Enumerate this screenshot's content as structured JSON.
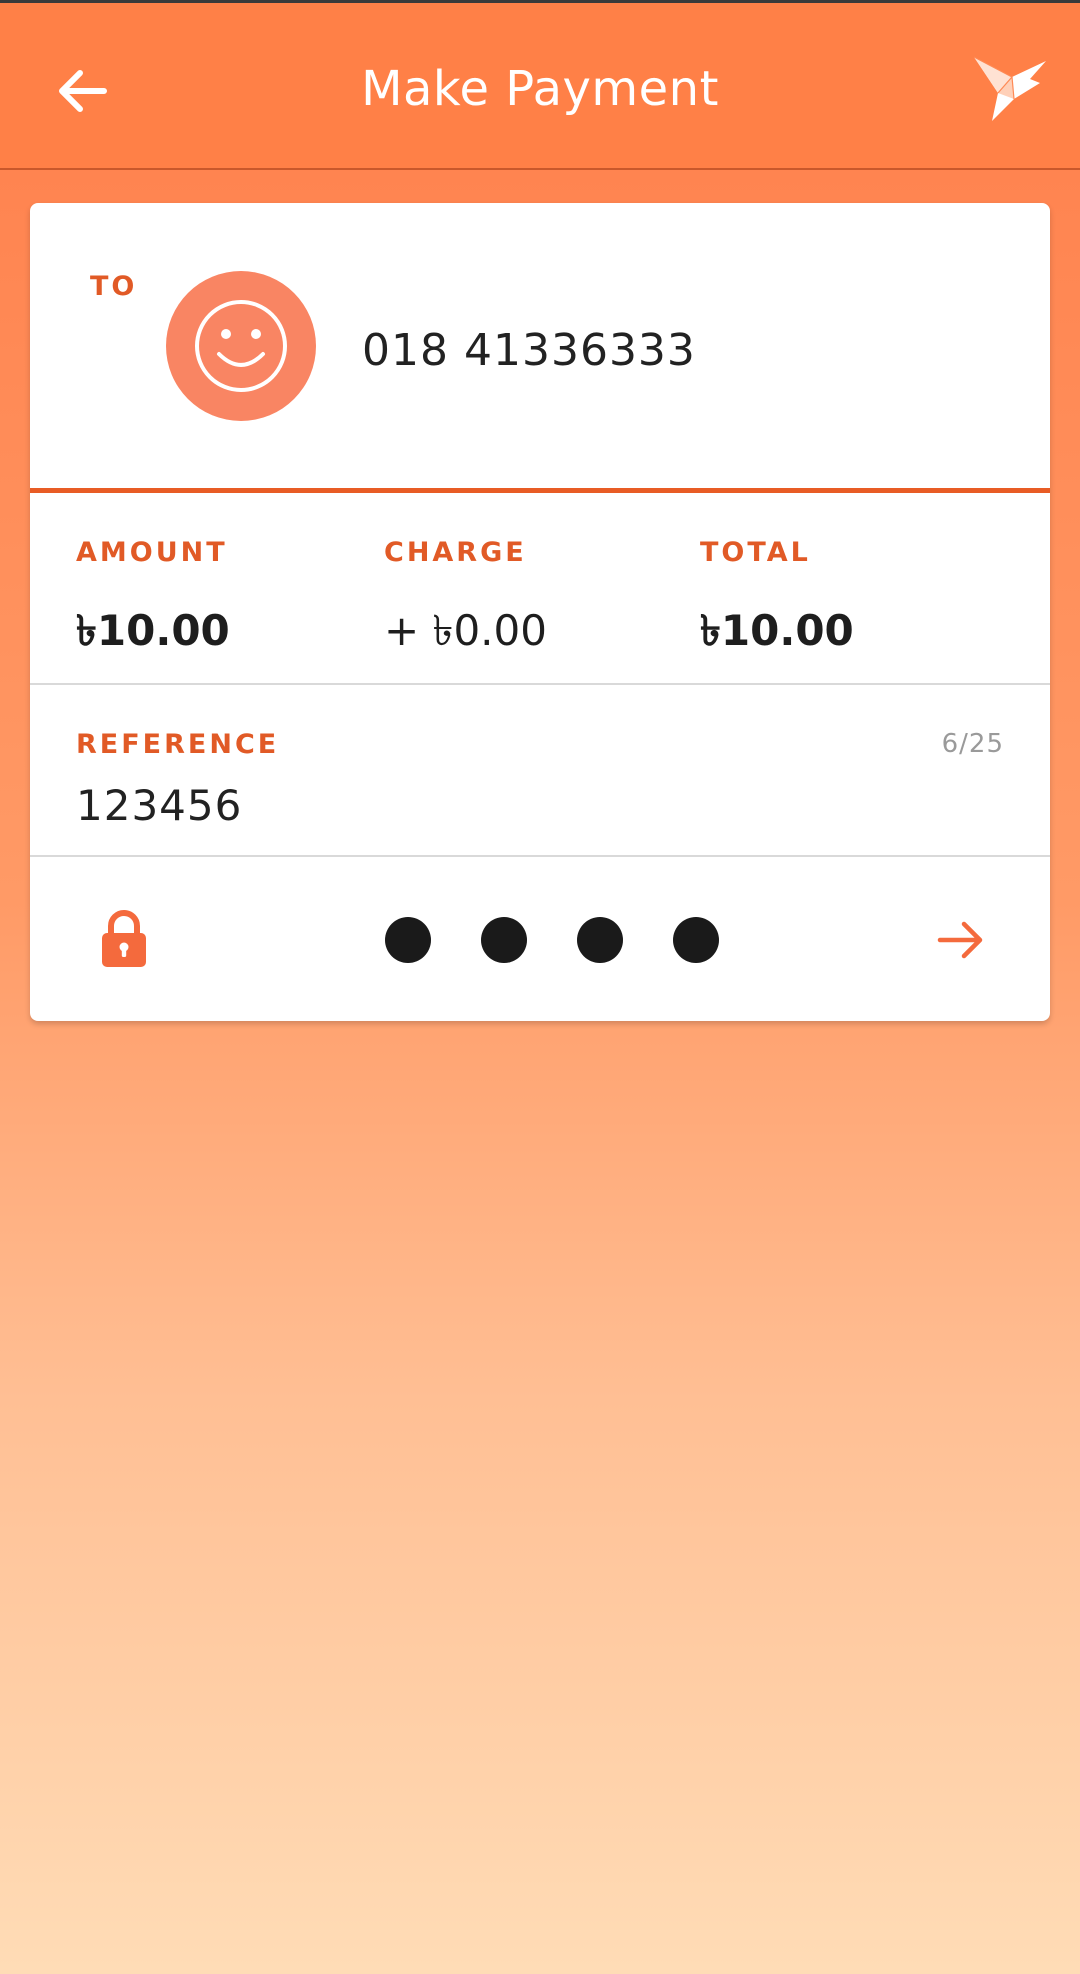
{
  "header": {
    "title": "Make Payment",
    "back_icon": "arrow-left-icon",
    "logo_icon": "origami-bird-logo"
  },
  "recipient": {
    "label": "TO",
    "avatar_icon": "smiley-face-icon",
    "number": "018 41336333"
  },
  "summary": {
    "amount_label": "AMOUNT",
    "amount_value": "৳10.00",
    "charge_label": "CHARGE",
    "charge_value": "+ ৳0.00",
    "total_label": "TOTAL",
    "total_value": "৳10.00"
  },
  "reference": {
    "label": "REFERENCE",
    "value": "123456",
    "counter": "6/25"
  },
  "pin": {
    "lock_icon": "lock-icon",
    "digits_entered": 4,
    "next_icon": "arrow-right-icon"
  },
  "colors": {
    "accent": "#e15a26",
    "header": "#ff8047",
    "avatar": "#f98563"
  }
}
